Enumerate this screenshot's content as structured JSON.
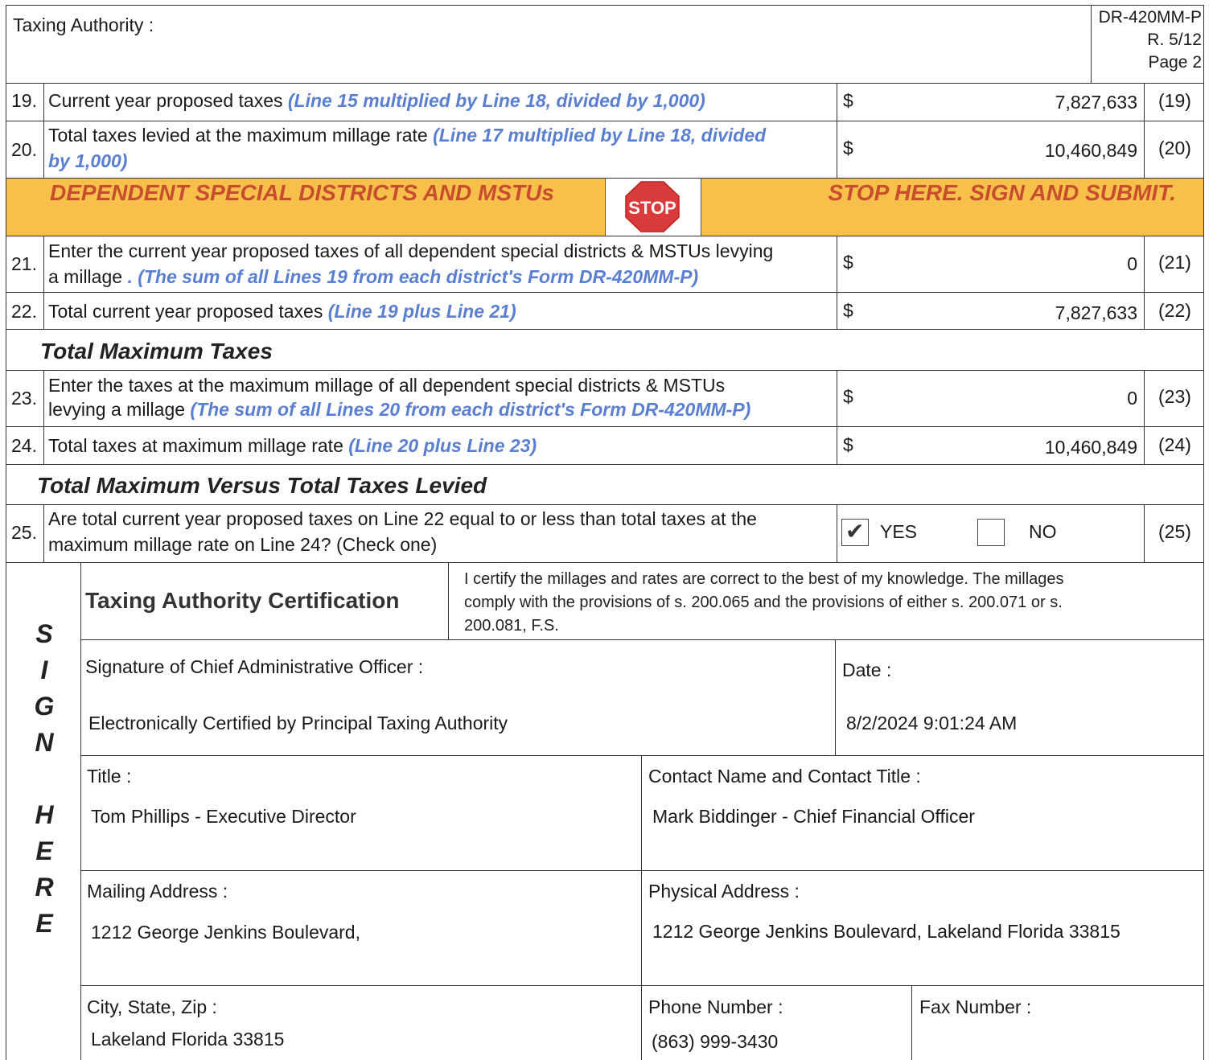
{
  "header": {
    "taxing_authority_label": "Taxing Authority :",
    "form_id": "DR-420MM-P",
    "revision": "R. 5/12",
    "page": "Page 2"
  },
  "lines": {
    "l19": {
      "num": "19.",
      "text": "Current year proposed taxes",
      "note": "(Line 15 multiplied by Line 18, divided by 1,000)",
      "dollar": "$",
      "value": "7,827,633",
      "ref": "(19)"
    },
    "l20": {
      "num": "20.",
      "text": "Total taxes levied at the maximum millage rate",
      "note_a": "(Line 17 multiplied by Line 18, divided",
      "note_b": "by 1,000)",
      "dollar": "$",
      "value": "10,460,849",
      "ref": "(20)"
    },
    "l21": {
      "num": "21.",
      "text_a": "Enter the current year proposed taxes of all dependent special districts & MSTUs levying",
      "text_b": "a millage",
      "note": ". (The sum of all Lines 19 from each district's Form DR-420MM-P)",
      "dollar": "$",
      "value": "0",
      "ref": "(21)"
    },
    "l22": {
      "num": "22.",
      "text": "Total current year proposed taxes",
      "note": "(Line 19 plus Line 21)",
      "dollar": "$",
      "value": "7,827,633",
      "ref": "(22)"
    },
    "l23": {
      "num": "23.",
      "text_a": "Enter the taxes at the maximum millage of all dependent special districts & MSTUs",
      "text_b": "levying a millage",
      "note": "(The sum of all Lines 20 from each district's Form DR-420MM-P)",
      "dollar": "$",
      "value": "0",
      "ref": "(23)"
    },
    "l24": {
      "num": "24.",
      "text": "Total taxes at maximum millage rate",
      "note": "(Line 20 plus Line 23)",
      "dollar": "$",
      "value": "10,460,849",
      "ref": "(24)"
    },
    "l25": {
      "num": "25.",
      "text_a": "Are total current year proposed taxes on Line 22 equal to or less than total taxes at the",
      "text_b": "maximum millage rate on Line 24? (Check one)",
      "yes_label": "YES",
      "no_label": "NO",
      "yes_checked": true,
      "no_checked": false,
      "ref": "(25)"
    }
  },
  "banner": {
    "left": "DEPENDENT SPECIAL DISTRICTS AND MSTUs",
    "stop": "STOP",
    "right": "STOP HERE. SIGN AND SUBMIT."
  },
  "sections": {
    "total_max": "Total Maximum Taxes",
    "versus": "Total Maximum Versus Total Taxes Levied"
  },
  "sign_letters": [
    "S",
    "I",
    "G",
    "N",
    "H",
    "E",
    "R",
    "E"
  ],
  "certification": {
    "title": "Taxing Authority Certification",
    "statement_1": "I certify the millages and rates are correct to the best of my knowledge. The millages",
    "statement_2": "comply with the provisions of s. 200.065 and the provisions of either s. 200.071 or s.",
    "statement_3": "200.081, F.S.",
    "signature_label": "Signature of Chief Administrative Officer :",
    "signature_value": "Electronically Certified by Principal Taxing Authority",
    "date_label": "Date :",
    "date_value": "8/2/2024 9:01:24 AM",
    "title_label": "Title :",
    "title_value": "Tom Phillips - Executive Director",
    "contact_label": "Contact Name and Contact Title :",
    "contact_value": "Mark Biddinger - Chief Financial Officer",
    "mailing_label": "Mailing Address :",
    "mailing_value": "1212 George Jenkins Boulevard,",
    "physical_label": "Physical Address :",
    "physical_value": "1212 George Jenkins Boulevard, Lakeland Florida 33815",
    "city_label": "City, State, Zip :",
    "city_value": "Lakeland Florida 33815",
    "phone_label": "Phone Number :",
    "phone_value": "(863) 999-3430",
    "fax_label": "Fax Number :"
  },
  "colors": {
    "banner_fill": "#f6c04a",
    "banner_text": "#c0392b",
    "note_blue": "#5a7fd0",
    "stop_red": "#d93a3a"
  }
}
